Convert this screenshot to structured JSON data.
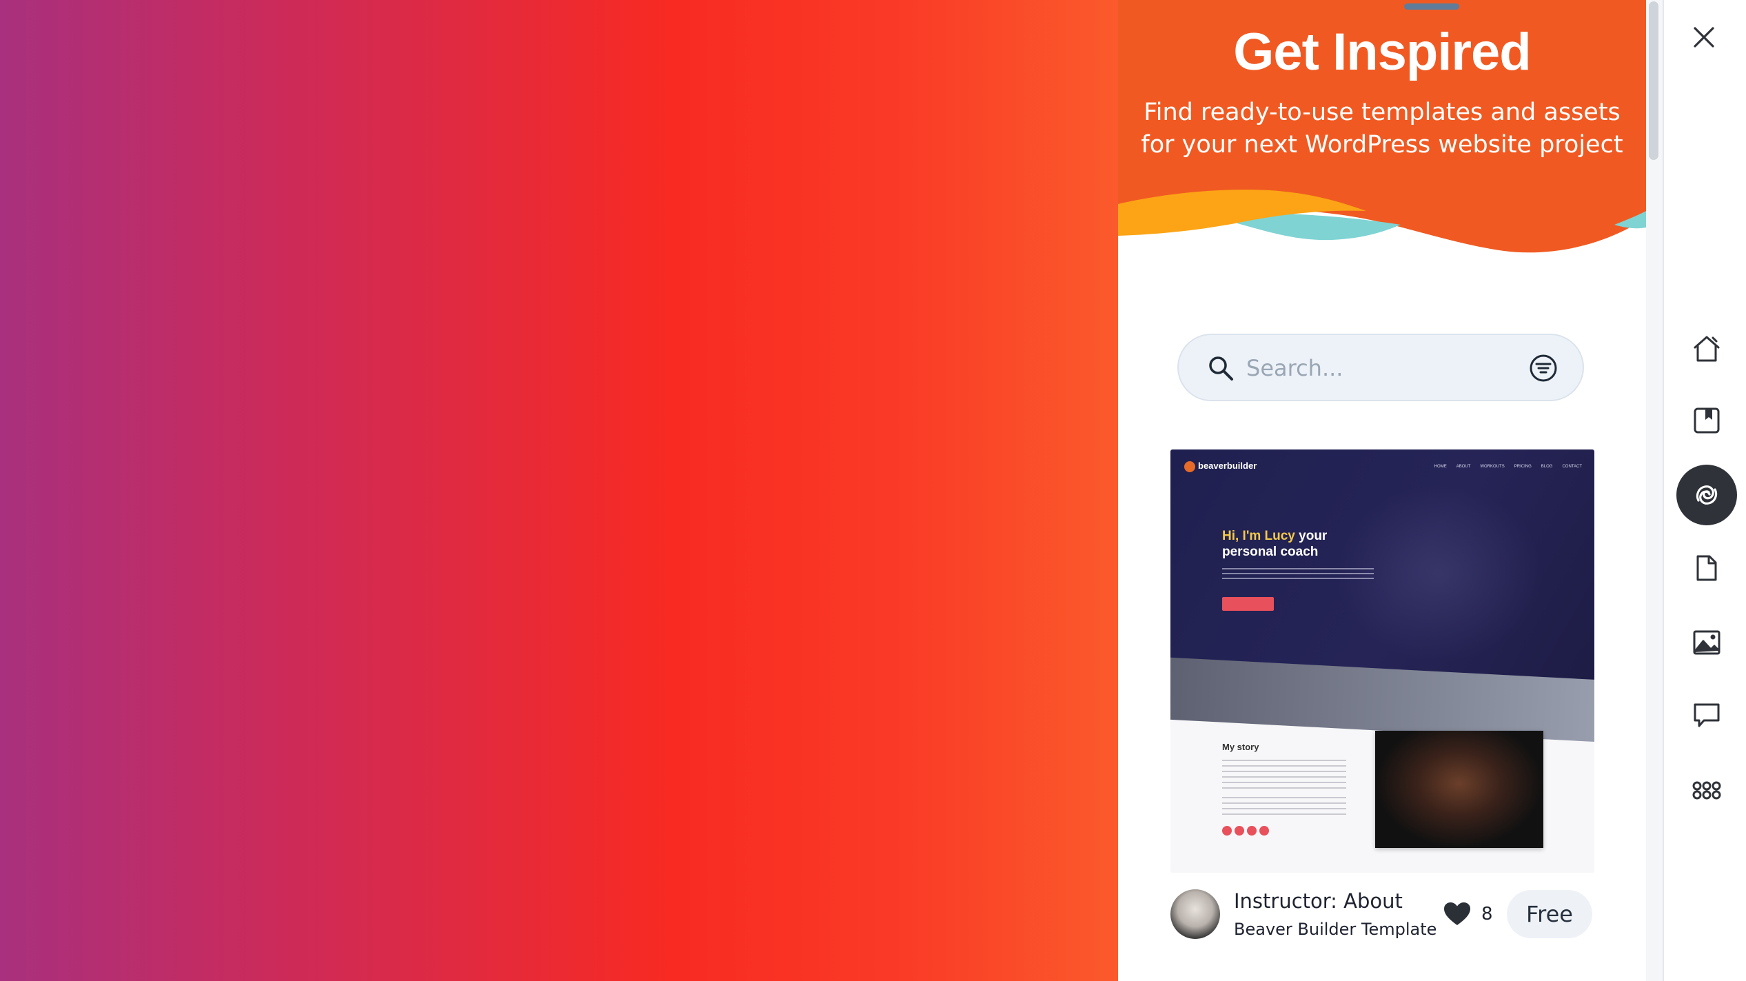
{
  "header": {
    "title": "Get Inspired",
    "subtitle_line1": "Find ready-to-use templates and assets",
    "subtitle_line2": "for your next WordPress website project"
  },
  "search": {
    "placeholder": "Search...",
    "value": ""
  },
  "template_card": {
    "preview": {
      "logo_text": "beaverbuilder",
      "nav_items": [
        "HOME",
        "ABOUT",
        "WORKOUTS",
        "PRICING",
        "BLOG",
        "CONTACT"
      ],
      "hero_title_highlight": "Hi, I'm Lucy",
      "hero_title_rest": " your personal coach",
      "section_title": "My story"
    },
    "title": "Instructor: About",
    "subtitle": "Beaver Builder Template",
    "likes": "8",
    "price": "Free"
  },
  "sidebar": {
    "items": [
      {
        "icon": "home-icon",
        "active": false
      },
      {
        "icon": "bookmark-icon",
        "active": false
      },
      {
        "icon": "inspire-swirl-icon",
        "active": true
      },
      {
        "icon": "page-icon",
        "active": false
      },
      {
        "icon": "image-icon",
        "active": false
      },
      {
        "icon": "chat-icon",
        "active": false
      },
      {
        "icon": "apps-grid-icon",
        "active": false
      }
    ]
  },
  "colors": {
    "header_orange": "#f05a22",
    "wave_yellow": "#fca416",
    "wave_teal": "#7fd3d3",
    "active_nav": "#2f3339",
    "accent_red": "#e8505b"
  }
}
